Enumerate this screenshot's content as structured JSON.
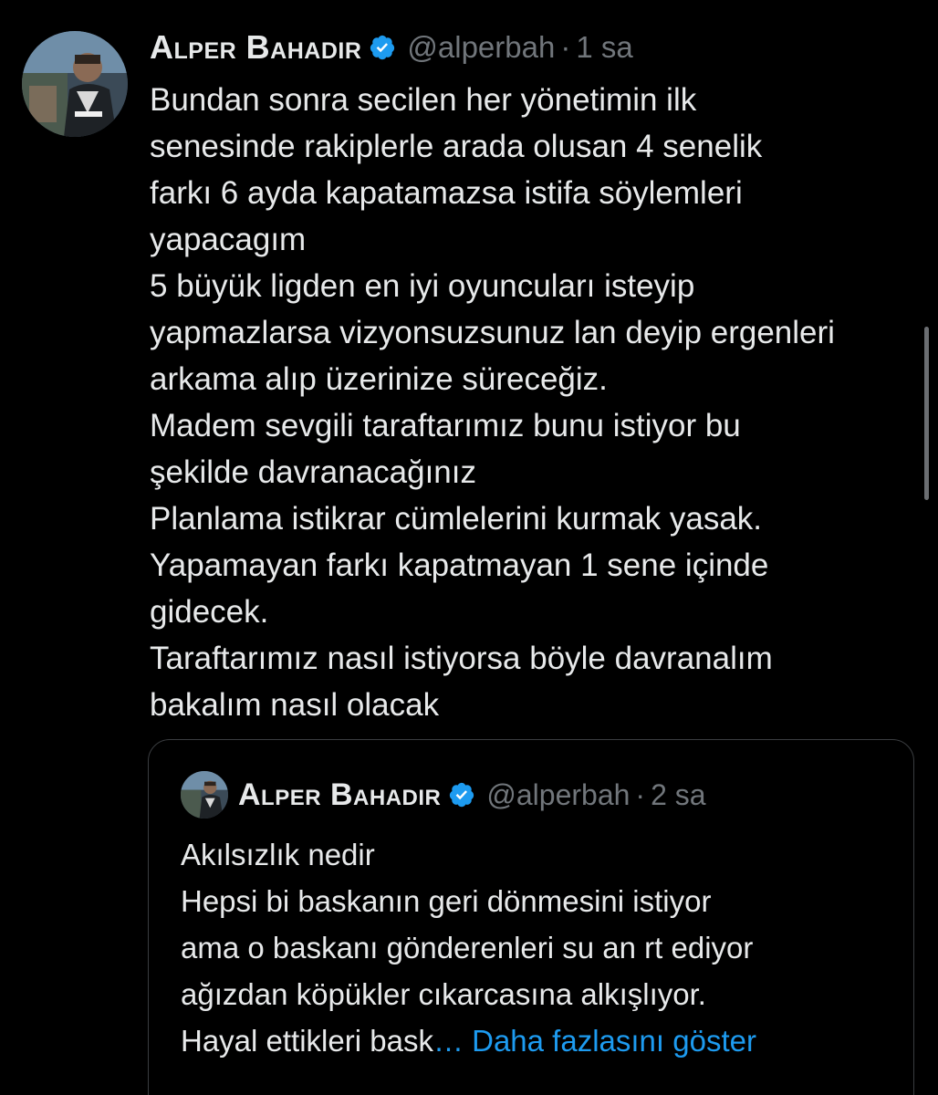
{
  "tweet": {
    "display_name": "Alper Bahadır",
    "handle": "@alperbah",
    "separator": "·",
    "time": "1 sa",
    "text": "Bundan sonra secilen her yönetimin ilk\nsenesinde rakiplerle arada olusan 4 senelik\nfarkı 6 ayda kapatamazsa istifa söylemleri\nyapacagım\n5 büyük ligden en iyi oyuncuları isteyip\nyapmazlarsa vizyonsuzsunuz lan deyip ergenleri\narkama alıp üzerinize süreceğiz.\nMadem sevgili taraftarımız bunu istiyor bu\nşekilde davranacağınız\nPlanlama istikrar cümlelerini kurmak yasak.\nYapamayan farkı kapatmayan 1 sene içinde\ngidecek.\nTaraftarımız nasıl istiyorsa böyle davranalım\nbakalım nasıl olacak"
  },
  "quote": {
    "display_name": "Alper Bahadır",
    "handle": "@alperbah",
    "separator": "·",
    "time": "2 sa",
    "text": "Akılsızlık nedir\nHepsi bi baskanın geri dönmesini istiyor\nama o baskanı gönderenleri su an rt ediyor\nağızdan köpükler cıkarcasına alkışlıyor.\nHayal ettikleri bask",
    "show_more": "… Daha fazlasını göster"
  },
  "icons": {
    "verified": "verified-badge-icon",
    "more": "more-options-icon"
  },
  "colors": {
    "background": "#000000",
    "text": "#e7e9ea",
    "muted": "#71767b",
    "accent": "#1d9bf0",
    "border": "#3a3d40"
  }
}
